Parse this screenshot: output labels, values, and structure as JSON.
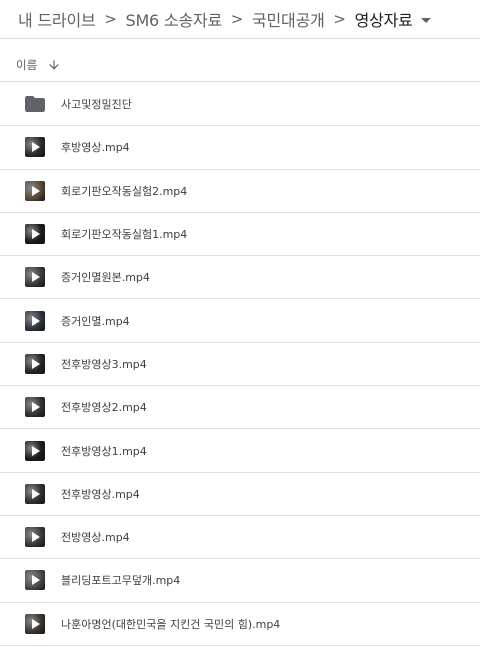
{
  "breadcrumb": {
    "items": [
      "내 드라이브",
      "SM6 소송자료",
      "국민대공개",
      "영상자료"
    ],
    "separator": ">"
  },
  "header": {
    "sort_label": "이름"
  },
  "colors": {
    "text_primary": "#202124",
    "text_secondary": "#5f6368",
    "divider": "#dadce0",
    "folder": "#5f6368"
  },
  "files": [
    {
      "name": "사고및정밀진단",
      "type": "folder",
      "icon": "folder-icon"
    },
    {
      "name": "후방영상.mp4",
      "type": "video",
      "icon": "video-thumbnail-icon",
      "thumb_color": "#2a2a2a"
    },
    {
      "name": "회로기판오작동실험2.mp4",
      "type": "video",
      "icon": "video-thumbnail-icon",
      "thumb_color": "#5a4a3a"
    },
    {
      "name": "회로기판오작동실험1.mp4",
      "type": "video",
      "icon": "video-thumbnail-icon",
      "thumb_color": "#1a1a1a"
    },
    {
      "name": "증거인멸원본.mp4",
      "type": "video",
      "icon": "video-thumbnail-icon",
      "thumb_color": "#3a3a3a"
    },
    {
      "name": "증거인멸.mp4",
      "type": "video",
      "icon": "video-thumbnail-icon",
      "thumb_color": "#2e3440"
    },
    {
      "name": "전후방영상3.mp4",
      "type": "video",
      "icon": "video-thumbnail-icon",
      "thumb_color": "#262626"
    },
    {
      "name": "전후방영상2.mp4",
      "type": "video",
      "icon": "video-thumbnail-icon",
      "thumb_color": "#333333"
    },
    {
      "name": "전후방영상1.mp4",
      "type": "video",
      "icon": "video-thumbnail-icon",
      "thumb_color": "#1c1c1c"
    },
    {
      "name": "전후방영상.mp4",
      "type": "video",
      "icon": "video-thumbnail-icon",
      "thumb_color": "#303030"
    },
    {
      "name": "전방영상.mp4",
      "type": "video",
      "icon": "video-thumbnail-icon",
      "thumb_color": "#3a3a3a"
    },
    {
      "name": "블리딩포트고무덮개.mp4",
      "type": "video",
      "icon": "video-thumbnail-icon",
      "thumb_color": "#4a4a4a"
    },
    {
      "name": "나훈아명언(대한민국을 지킨건 국민의 힘).mp4",
      "type": "video",
      "icon": "video-thumbnail-icon",
      "thumb_color": "#3d3530"
    }
  ]
}
